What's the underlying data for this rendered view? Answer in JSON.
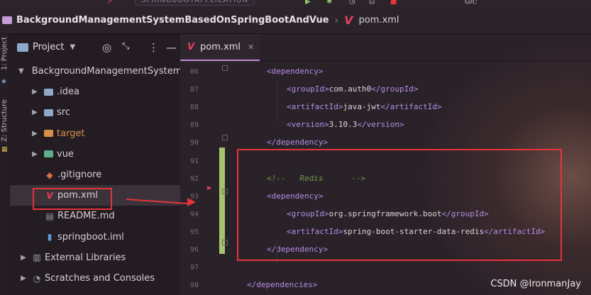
{
  "window": {
    "run_config_label": "SPRINGBOOTAPPLICATION",
    "git_label": "Git:"
  },
  "breadcrumb": {
    "project": "BackgroundManagementSystemBasedOnSpringBootAndVue",
    "file": "pom.xml"
  },
  "tool_stripe": {
    "project_label": "1: Project",
    "structure_label": "Z: Structure"
  },
  "project_panel": {
    "title": "Project",
    "tools": [
      "target-icon",
      "collapse-icon",
      "more-icon",
      "minimize-icon"
    ],
    "tree": [
      {
        "label": "BackgroundManagementSystem",
        "arrow": "▼",
        "icon": "folder"
      },
      {
        "label": ".idea",
        "arrow": "▶",
        "icon": "folder"
      },
      {
        "label": "src",
        "arrow": "▶",
        "icon": "folder"
      },
      {
        "label": "target",
        "arrow": "▶",
        "icon": "folder-orange"
      },
      {
        "label": "vue",
        "arrow": "▶",
        "icon": "folder-vue"
      },
      {
        "label": ".gitignore",
        "arrow": "",
        "icon": "gitignore"
      },
      {
        "label": "pom.xml",
        "arrow": "",
        "icon": "vue"
      },
      {
        "label": "README.md",
        "arrow": "",
        "icon": "markdown"
      },
      {
        "label": "springboot.iml",
        "arrow": "",
        "icon": "iml"
      },
      {
        "label": "External Libraries",
        "arrow": "▶",
        "icon": "libraries"
      },
      {
        "label": "Scratches and Consoles",
        "arrow": "▶",
        "icon": "scratches"
      }
    ]
  },
  "editor": {
    "tab_label": "pom.xml",
    "lines": [
      {
        "num": "86",
        "indent": 0,
        "parts": [
          [
            "tag",
            "<dependency>"
          ]
        ]
      },
      {
        "num": "87",
        "indent": 1,
        "parts": [
          [
            "tag",
            "<groupId>"
          ],
          [
            "txt",
            "com.auth0"
          ],
          [
            "tag",
            "</groupId>"
          ]
        ]
      },
      {
        "num": "88",
        "indent": 1,
        "parts": [
          [
            "tag",
            "<artifactId>"
          ],
          [
            "txt",
            "java-jwt"
          ],
          [
            "tag",
            "</artifactId>"
          ]
        ]
      },
      {
        "num": "89",
        "indent": 1,
        "parts": [
          [
            "tag",
            "<version>"
          ],
          [
            "txt",
            "3.10.3"
          ],
          [
            "tag",
            "</version>"
          ]
        ]
      },
      {
        "num": "90",
        "indent": 0,
        "parts": [
          [
            "tag",
            "</dependency>"
          ]
        ]
      },
      {
        "num": "91",
        "indent": 0,
        "parts": []
      },
      {
        "num": "92",
        "indent": 0,
        "parts": [
          [
            "cmt",
            "<!--   Redis      -->"
          ]
        ]
      },
      {
        "num": "93",
        "indent": 0,
        "parts": [
          [
            "tag",
            "<dependency>"
          ]
        ]
      },
      {
        "num": "94",
        "indent": 1,
        "parts": [
          [
            "tag",
            "<groupId>"
          ],
          [
            "txt",
            "org.springframework.boot"
          ],
          [
            "tag",
            "</groupId>"
          ]
        ]
      },
      {
        "num": "95",
        "indent": 1,
        "parts": [
          [
            "tag",
            "<artifactId>"
          ],
          [
            "txt",
            "spring-boot-starter-data-redis"
          ],
          [
            "tag",
            "</artifactId>"
          ]
        ]
      },
      {
        "num": "96",
        "indent": 0,
        "parts": [
          [
            "tag",
            "</dependency>"
          ]
        ]
      },
      {
        "num": "97",
        "indent": 0,
        "parts": []
      },
      {
        "num": "98",
        "indent": -1,
        "parts": [
          [
            "tag",
            "</dependencies>"
          ]
        ]
      }
    ]
  },
  "watermark": "CSDN @IronmanJay",
  "colors": {
    "annotation_red": "#e5343b",
    "vcs_added": "#a8c36f",
    "xml_tag": "#b48ee8",
    "comment": "#6d9a4a"
  }
}
